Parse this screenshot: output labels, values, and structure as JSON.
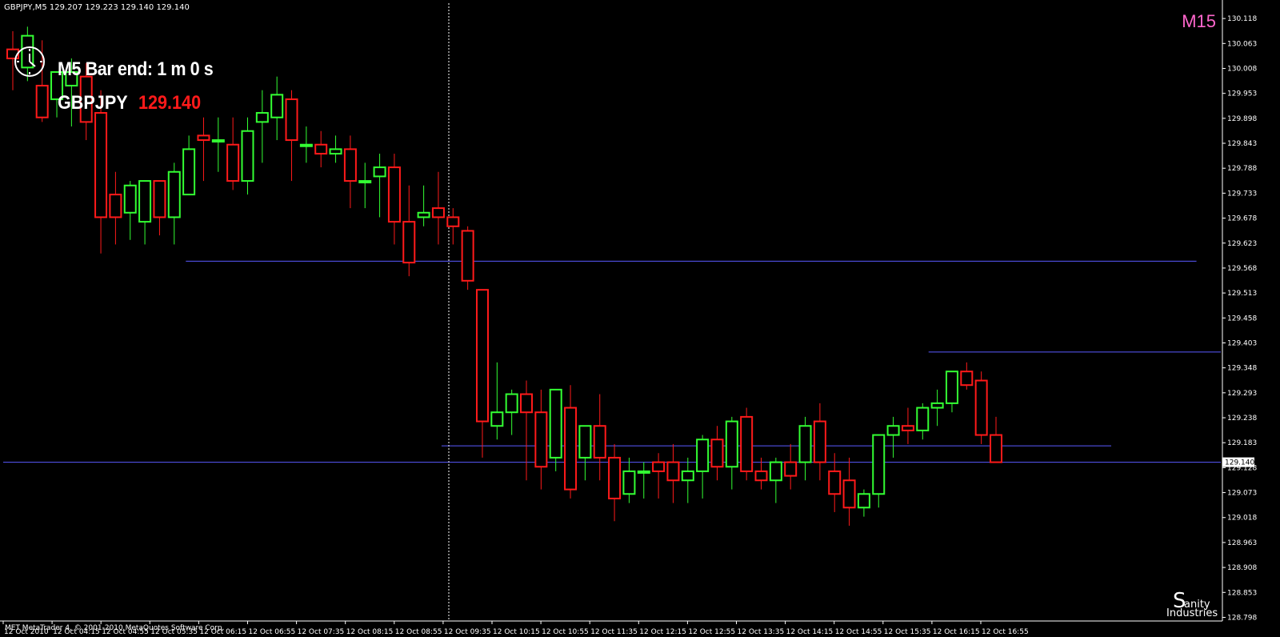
{
  "window": {
    "symbol_info": "GBPJPY,M5  129.207 129.223 129.140 129.140",
    "timeframe_label": "M15",
    "copyright": "MET MetaTrader 4, © 2001-2010 MetaQuotes Software Corp."
  },
  "indicator": {
    "bar_end_text": "M5 Bar end: 1 m 0 s",
    "symbol": "GBPJPY",
    "price": "129.140"
  },
  "watermark": {
    "glyph": "S",
    "line1": "anity",
    "line2": "Industries"
  },
  "colors": {
    "background": "#000000",
    "bull": "#33ff33",
    "bear": "#ff1a1a",
    "level_line": "#5a5aff",
    "axis": "#ffffff",
    "price_highlight": "#ff1a1a",
    "timeframe": "#ff66cc"
  },
  "price_axis": {
    "min": 128.79,
    "max": 130.12,
    "ticks": [
      "130.118",
      "130.063",
      "130.008",
      "129.953",
      "129.898",
      "129.843",
      "129.788",
      "129.733",
      "129.678",
      "129.623",
      "129.568",
      "129.513",
      "129.458",
      "129.403",
      "129.348",
      "129.293",
      "129.238",
      "129.183",
      "129.128",
      "129.073",
      "129.018",
      "128.963",
      "128.908",
      "128.853",
      "128.798"
    ],
    "current_price_label": "129.140"
  },
  "time_axis": {
    "labels": [
      "12 Oct 2010",
      "12 Oct 04:15",
      "12 Oct 04:55",
      "12 Oct 05:35",
      "12 Oct 06:15",
      "12 Oct 06:55",
      "12 Oct 07:35",
      "12 Oct 08:15",
      "12 Oct 08:55",
      "12 Oct 09:35",
      "12 Oct 10:15",
      "12 Oct 10:55",
      "12 Oct 11:35",
      "12 Oct 12:15",
      "12 Oct 12:55",
      "12 Oct 13:35",
      "12 Oct 14:15",
      "12 Oct 14:55",
      "12 Oct 15:35",
      "12 Oct 16:15",
      "12 Oct 16:55"
    ]
  },
  "levels": [
    {
      "price": 129.583,
      "start_bar": 0.15,
      "end_bar": 0.98
    },
    {
      "price": 129.383,
      "start_bar": 0.76,
      "end_bar": 1.0
    },
    {
      "price": 129.176,
      "start_bar": 0.36,
      "end_bar": 0.91
    },
    {
      "price": 129.14,
      "start_bar": 0.0,
      "end_bar": 1.0
    }
  ],
  "candles": [
    [
      130.05,
      130.09,
      130.03,
      129.96
    ],
    [
      130.01,
      130.1,
      130.08,
      129.98
    ],
    [
      129.97,
      130.07,
      129.9,
      129.89
    ],
    [
      129.94,
      129.98,
      130.0,
      129.9
    ],
    [
      129.97,
      130.03,
      130.0,
      129.88
    ],
    [
      129.99,
      130.02,
      129.89,
      129.85
    ],
    [
      129.91,
      129.96,
      129.68,
      129.6
    ],
    [
      129.73,
      129.78,
      129.68,
      129.62
    ],
    [
      129.69,
      129.76,
      129.75,
      129.63
    ],
    [
      129.67,
      129.74,
      129.76,
      129.62
    ],
    [
      129.76,
      129.76,
      129.68,
      129.64
    ],
    [
      129.68,
      129.8,
      129.78,
      129.62
    ],
    [
      129.73,
      129.86,
      129.83,
      129.76
    ],
    [
      129.86,
      129.9,
      129.85,
      129.76
    ],
    [
      129.85,
      129.9,
      129.85,
      129.78
    ],
    [
      129.84,
      129.9,
      129.76,
      129.74
    ],
    [
      129.76,
      129.9,
      129.87,
      129.73
    ],
    [
      129.89,
      129.96,
      129.91,
      129.8
    ],
    [
      129.9,
      129.99,
      129.95,
      129.85
    ],
    [
      129.94,
      129.96,
      129.85,
      129.76
    ],
    [
      129.84,
      129.88,
      129.84,
      129.8
    ],
    [
      129.84,
      129.87,
      129.82,
      129.79
    ],
    [
      129.82,
      129.86,
      129.83,
      129.8
    ],
    [
      129.83,
      129.86,
      129.76,
      129.7
    ],
    [
      129.76,
      129.8,
      129.76,
      129.7
    ],
    [
      129.77,
      129.82,
      129.79,
      129.68
    ],
    [
      129.79,
      129.82,
      129.67,
      129.62
    ],
    [
      129.67,
      129.75,
      129.58,
      129.55
    ],
    [
      129.68,
      129.75,
      129.69,
      129.66
    ],
    [
      129.7,
      129.78,
      129.68,
      129.62
    ],
    [
      129.68,
      129.7,
      129.66,
      129.62
    ],
    [
      129.65,
      129.66,
      129.54,
      129.52
    ],
    [
      129.52,
      129.52,
      129.23,
      129.15
    ],
    [
      129.22,
      129.36,
      129.25,
      129.19
    ],
    [
      129.25,
      129.3,
      129.29,
      129.2
    ],
    [
      129.29,
      129.32,
      129.25,
      129.1
    ],
    [
      129.25,
      129.3,
      129.13,
      129.08
    ],
    [
      129.15,
      129.3,
      129.3,
      129.12
    ],
    [
      129.26,
      129.31,
      129.08,
      129.06
    ],
    [
      129.15,
      129.2,
      129.22,
      129.1
    ],
    [
      129.22,
      129.29,
      129.15,
      129.1
    ],
    [
      129.15,
      129.18,
      129.06,
      129.01
    ],
    [
      129.07,
      129.15,
      129.12,
      129.05
    ],
    [
      129.12,
      129.14,
      129.12,
      129.06
    ],
    [
      129.14,
      129.16,
      129.12,
      129.06
    ],
    [
      129.14,
      129.18,
      129.1,
      129.05
    ],
    [
      129.1,
      129.15,
      129.12,
      129.05
    ],
    [
      129.12,
      129.2,
      129.19,
      129.06
    ],
    [
      129.19,
      129.22,
      129.13,
      129.1
    ],
    [
      129.13,
      129.24,
      129.23,
      129.08
    ],
    [
      129.24,
      129.26,
      129.12,
      129.1
    ],
    [
      129.12,
      129.15,
      129.1,
      129.08
    ],
    [
      129.1,
      129.15,
      129.14,
      129.05
    ],
    [
      129.14,
      129.18,
      129.11,
      129.08
    ],
    [
      129.14,
      129.24,
      129.22,
      129.1
    ],
    [
      129.23,
      129.27,
      129.14,
      129.1
    ],
    [
      129.12,
      129.16,
      129.07,
      129.03
    ],
    [
      129.1,
      129.15,
      129.04,
      129.0
    ],
    [
      129.04,
      129.08,
      129.07,
      129.02
    ],
    [
      129.07,
      129.2,
      129.2,
      129.04
    ],
    [
      129.2,
      129.24,
      129.22,
      129.15
    ],
    [
      129.22,
      129.26,
      129.21,
      129.18
    ],
    [
      129.21,
      129.27,
      129.26,
      129.19
    ],
    [
      129.26,
      129.3,
      129.27,
      129.22
    ],
    [
      129.27,
      129.32,
      129.34,
      129.25
    ],
    [
      129.34,
      129.36,
      129.31,
      129.3
    ],
    [
      129.32,
      129.34,
      129.2,
      129.18
    ],
    [
      129.2,
      129.24,
      129.14,
      129.14
    ]
  ]
}
